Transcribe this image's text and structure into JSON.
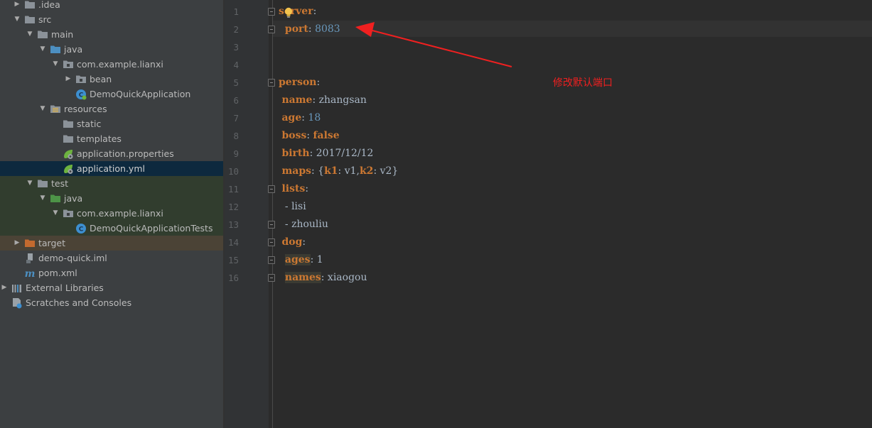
{
  "project_tree": [
    {
      "label": ".idea",
      "level": 1,
      "arrow": "right",
      "icon": "folder-icon"
    },
    {
      "label": "src",
      "level": 1,
      "arrow": "down",
      "icon": "folder-icon"
    },
    {
      "label": "main",
      "level": 2,
      "arrow": "down",
      "icon": "folder-icon"
    },
    {
      "label": "java",
      "level": 3,
      "arrow": "down",
      "icon": "source-folder-icon"
    },
    {
      "label": "com.example.lianxi",
      "level": 4,
      "arrow": "down",
      "icon": "package-icon"
    },
    {
      "label": "bean",
      "level": 5,
      "arrow": "right",
      "icon": "package-icon"
    },
    {
      "label": "DemoQuickApplication",
      "level": 5,
      "arrow": "none",
      "icon": "spring-boot-class-icon"
    },
    {
      "label": "resources",
      "level": 3,
      "arrow": "down",
      "icon": "resources-folder-icon"
    },
    {
      "label": "static",
      "level": 4,
      "arrow": "none",
      "icon": "folder-icon"
    },
    {
      "label": "templates",
      "level": 4,
      "arrow": "none",
      "icon": "folder-icon"
    },
    {
      "label": "application.properties",
      "level": 4,
      "arrow": "none",
      "icon": "spring-config-icon"
    },
    {
      "label": "application.yml",
      "level": 4,
      "arrow": "none",
      "icon": "spring-config-icon",
      "selected": true
    },
    {
      "label": "test",
      "level": 2,
      "arrow": "down",
      "icon": "folder-icon",
      "scope": "test"
    },
    {
      "label": "java",
      "level": 3,
      "arrow": "down",
      "icon": "test-source-folder-icon",
      "scope": "test"
    },
    {
      "label": "com.example.lianxi",
      "level": 4,
      "arrow": "down",
      "icon": "package-icon",
      "scope": "test"
    },
    {
      "label": "DemoQuickApplicationTests",
      "level": 5,
      "arrow": "none",
      "icon": "test-class-icon",
      "scope": "test"
    },
    {
      "label": "target",
      "level": 1,
      "arrow": "right",
      "icon": "excluded-folder-icon",
      "scope": "excluded"
    },
    {
      "label": "demo-quick.iml",
      "level": 1,
      "arrow": "none",
      "icon": "iml-file-icon"
    },
    {
      "label": "pom.xml",
      "level": 1,
      "arrow": "none",
      "icon": "maven-icon"
    },
    {
      "label": "External Libraries",
      "level": 0,
      "arrow": "right",
      "icon": "libraries-icon"
    },
    {
      "label": "Scratches and Consoles",
      "level": 0,
      "arrow": "none",
      "icon": "scratches-icon"
    }
  ],
  "editor": {
    "line_numbers": [
      "1",
      "2",
      "3",
      "4",
      "5",
      "6",
      "7",
      "8",
      "9",
      "10",
      "11",
      "12",
      "13",
      "14",
      "15",
      "16"
    ],
    "lines": [
      [
        {
          "t": "server",
          "c": "k"
        },
        {
          "t": ":",
          "c": "p"
        }
      ],
      [
        {
          "t": "  "
        },
        {
          "t": "port",
          "c": "k"
        },
        {
          "t": ": ",
          "c": "p"
        },
        {
          "t": "8083",
          "c": "num"
        }
      ],
      [],
      [],
      [
        {
          "t": "person",
          "c": "k"
        },
        {
          "t": ":",
          "c": "p"
        }
      ],
      [
        {
          "t": " "
        },
        {
          "t": "name",
          "c": "k"
        },
        {
          "t": ": zhangsan",
          "c": "p"
        }
      ],
      [
        {
          "t": " "
        },
        {
          "t": "age",
          "c": "k"
        },
        {
          "t": ": ",
          "c": "p"
        },
        {
          "t": "18",
          "c": "num"
        }
      ],
      [
        {
          "t": " "
        },
        {
          "t": "boss",
          "c": "k"
        },
        {
          "t": ": ",
          "c": "p"
        },
        {
          "t": "false",
          "c": "k"
        }
      ],
      [
        {
          "t": " "
        },
        {
          "t": "birth",
          "c": "k"
        },
        {
          "t": ": 2017/12/12",
          "c": "p"
        }
      ],
      [
        {
          "t": " "
        },
        {
          "t": "maps",
          "c": "k"
        },
        {
          "t": ": {",
          "c": "p"
        },
        {
          "t": "k1",
          "c": "k"
        },
        {
          "t": ": v1,",
          "c": "p"
        },
        {
          "t": "k2",
          "c": "k"
        },
        {
          "t": ": v2}",
          "c": "p"
        }
      ],
      [
        {
          "t": " "
        },
        {
          "t": "lists",
          "c": "k"
        },
        {
          "t": ":",
          "c": "p"
        }
      ],
      [
        {
          "t": "  - lisi",
          "c": "p"
        }
      ],
      [
        {
          "t": "  - zhouliu",
          "c": "p"
        }
      ],
      [
        {
          "t": " "
        },
        {
          "t": "dog",
          "c": "k"
        },
        {
          "t": ":",
          "c": "p"
        }
      ],
      [
        {
          "t": "  "
        },
        {
          "t": "ages",
          "c": "k hl"
        },
        {
          "t": ": 1",
          "c": "p"
        }
      ],
      [
        {
          "t": "  "
        },
        {
          "t": "names",
          "c": "k hl"
        },
        {
          "t": ": xiaogou",
          "c": "p"
        }
      ]
    ],
    "fold_markers": [
      1,
      2,
      5,
      11,
      13,
      14,
      15,
      16
    ]
  },
  "annotation": {
    "text": "修改默认端口",
    "color": "#f02020"
  },
  "colors": {
    "sidebar_bg": "#3c3f41",
    "editor_bg": "#2b2b2b",
    "gutter_bg": "#313335",
    "selection_bg": "#0d293e",
    "keyword": "#cc7832",
    "number": "#6897bb",
    "text": "#a9b7c6",
    "annotation": "#f02020"
  },
  "icons": [
    "folder-icon",
    "source-folder-icon",
    "package-icon",
    "spring-boot-class-icon",
    "resources-folder-icon",
    "spring-config-icon",
    "test-source-folder-icon",
    "test-class-icon",
    "excluded-folder-icon",
    "iml-file-icon",
    "maven-icon",
    "libraries-icon",
    "scratches-icon",
    "lightbulb-icon",
    "fold-icon"
  ]
}
